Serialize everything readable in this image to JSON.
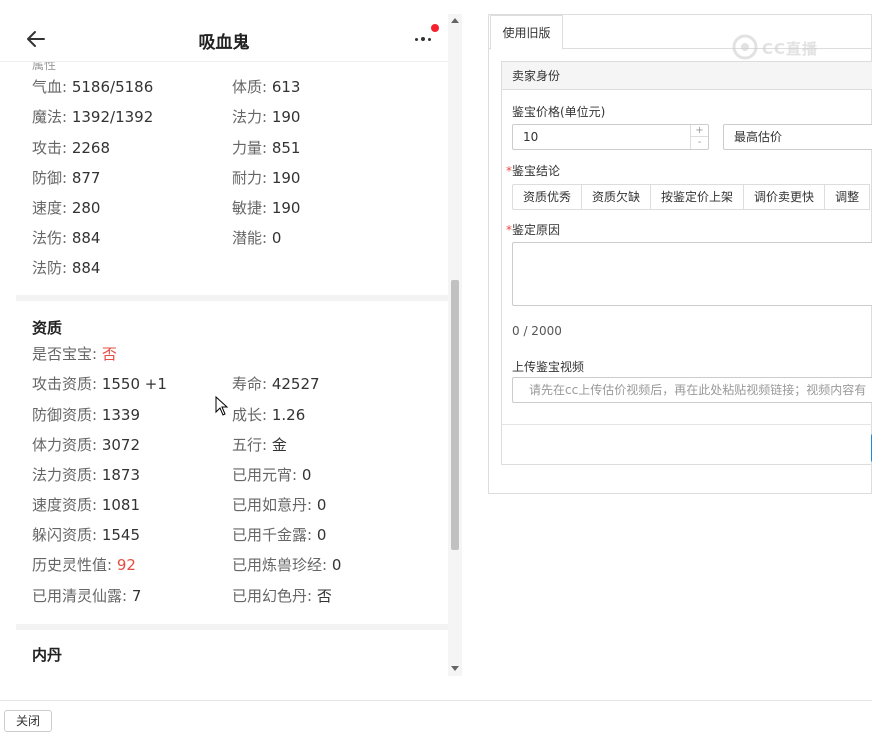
{
  "header": {
    "title": "吸血鬼",
    "top_cut_text": "属性"
  },
  "stats": [
    {
      "label": "气血:",
      "value": "5186/5186"
    },
    {
      "label": "体质:",
      "value": "613"
    },
    {
      "label": "魔法:",
      "value": "1392/1392"
    },
    {
      "label": "法力:",
      "value": "190"
    },
    {
      "label": "攻击:",
      "value": "2268"
    },
    {
      "label": "力量:",
      "value": "851"
    },
    {
      "label": "防御:",
      "value": "877"
    },
    {
      "label": "耐力:",
      "value": "190"
    },
    {
      "label": "速度:",
      "value": "280"
    },
    {
      "label": "敏捷:",
      "value": "190"
    },
    {
      "label": "法伤:",
      "value": "884"
    },
    {
      "label": "潜能:",
      "value": "0"
    },
    {
      "label": "法防:",
      "value": "884"
    }
  ],
  "aptitude": {
    "title": "资质",
    "is_baby": {
      "label": "是否宝宝:",
      "value": "否"
    },
    "items": [
      {
        "label": "攻击资质:",
        "value": "1550 +1"
      },
      {
        "label": "寿命:",
        "value": "42527"
      },
      {
        "label": "防御资质:",
        "value": "1339"
      },
      {
        "label": "成长:",
        "value": "1.26"
      },
      {
        "label": "体力资质:",
        "value": "3072"
      },
      {
        "label": "五行:",
        "value": "金"
      },
      {
        "label": "法力资质:",
        "value": "1873"
      },
      {
        "label": "已用元宵:",
        "value": "0"
      },
      {
        "label": "速度资质:",
        "value": "1081"
      },
      {
        "label": "已用如意丹:",
        "value": "0"
      },
      {
        "label": "躲闪资质:",
        "value": "1545"
      },
      {
        "label": "已用千金露:",
        "value": "0"
      },
      {
        "label": "历史灵性值:",
        "value": "92"
      },
      {
        "label": "已用炼兽珍经:",
        "value": "0"
      },
      {
        "label": "已用清灵仙露:",
        "value": "7"
      },
      {
        "label": "已用幻色丹:",
        "value": "否"
      }
    ]
  },
  "neidan": {
    "title": "内丹"
  },
  "right": {
    "tab_label": "使用旧版",
    "section_title": "卖家身份",
    "price_label": "鉴宝价格(单位元)",
    "price_value": "10",
    "stepper_up": "+",
    "stepper_down": "-",
    "estimate_value": "最高估价",
    "conclusion_label": "鉴宝结论",
    "conclusion_options": [
      "资质优秀",
      "资质欠缺",
      "按鉴定价上架",
      "调价卖更快",
      "调整"
    ],
    "reason_label": "鉴定原因",
    "char_count": "0 / 2000",
    "video_label": "上传鉴宝视频",
    "video_placeholder": "请先在cc上传估价视频后，再在此处粘贴视频链接；视频内容有",
    "required_mark": "*"
  },
  "footer": {
    "close_label": "关闭"
  },
  "watermark": {
    "text": "CC直播"
  }
}
